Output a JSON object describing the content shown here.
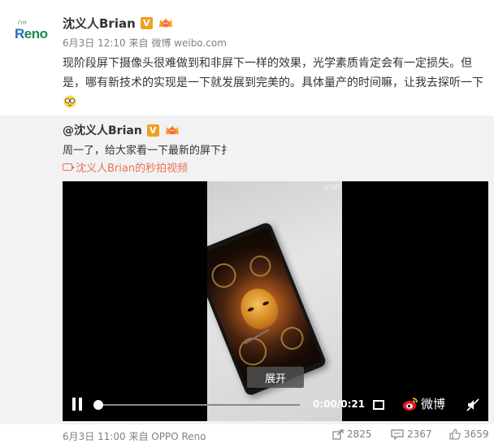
{
  "post": {
    "author": "沈义人Brian",
    "verified_label": "V",
    "avatar_text": {
      "tiny": "i'm",
      "r": "R",
      "rest": "eno"
    },
    "date": "6月3日 12:10",
    "source_prefix": "来自",
    "source": "微博 weibo.com",
    "content": "现阶段屏下摄像头很难做到和非屏下一样的效果，光学素质肯定会有一定损失。但是，哪有新技术的实现是一下就发展到完美的。具体量产的时间嘛，让我去探听一下"
  },
  "repost": {
    "author": "@沈义人Brian",
    "verified_label": "V",
    "text": "周一了，给大家看一下最新的屏下扌",
    "video_link": "沈义人Brian的秒拍视频"
  },
  "video": {
    "watermark": "@飞行",
    "expand_label": "展开",
    "time": "0:00/0:21",
    "progress": 0.0,
    "brand_label": "微博"
  },
  "footer": {
    "meta": "6月3日 11:00 来自 OPPO Reno",
    "forward_count": "2825",
    "comment_count": "2367",
    "like_count": "3659"
  },
  "colors": {
    "link": "#eb7350",
    "verified": "#f0a020",
    "repost_bg": "#f2f2f5",
    "meta_gray": "#808080"
  }
}
